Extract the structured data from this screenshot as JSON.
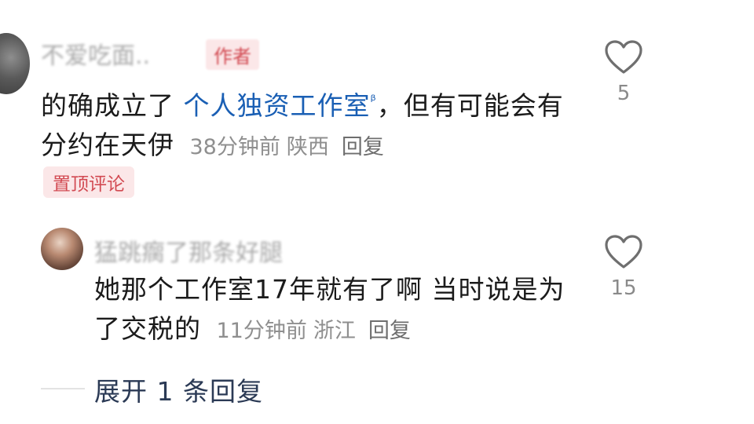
{
  "comments": [
    {
      "username": "不爱吃面..",
      "author_tag": "作者",
      "text_before": "的确成立了",
      "link": "个人独资工作室",
      "text_after": "，但有可能会有分约在天伊",
      "time": "38分钟前",
      "location": "陕西",
      "reply_label": "回复",
      "pinned_label": "置顶评论",
      "likes": "5"
    },
    {
      "username": "猛跳瘸了那条好腿",
      "text": "她那个工作室17年就有了啊 当时说是为了交税的",
      "time": "11分钟前",
      "location": "浙江",
      "reply_label": "回复",
      "likes": "15"
    }
  ],
  "expand_label": "展开 1 条回复",
  "icons": {
    "like": "heart-outline-icon",
    "link": "search-icon"
  },
  "colors": {
    "link": "#1a5fb4",
    "tag": "#d24a52",
    "tag_bg": "#fbe7e8",
    "meta": "#8f8f8f"
  }
}
